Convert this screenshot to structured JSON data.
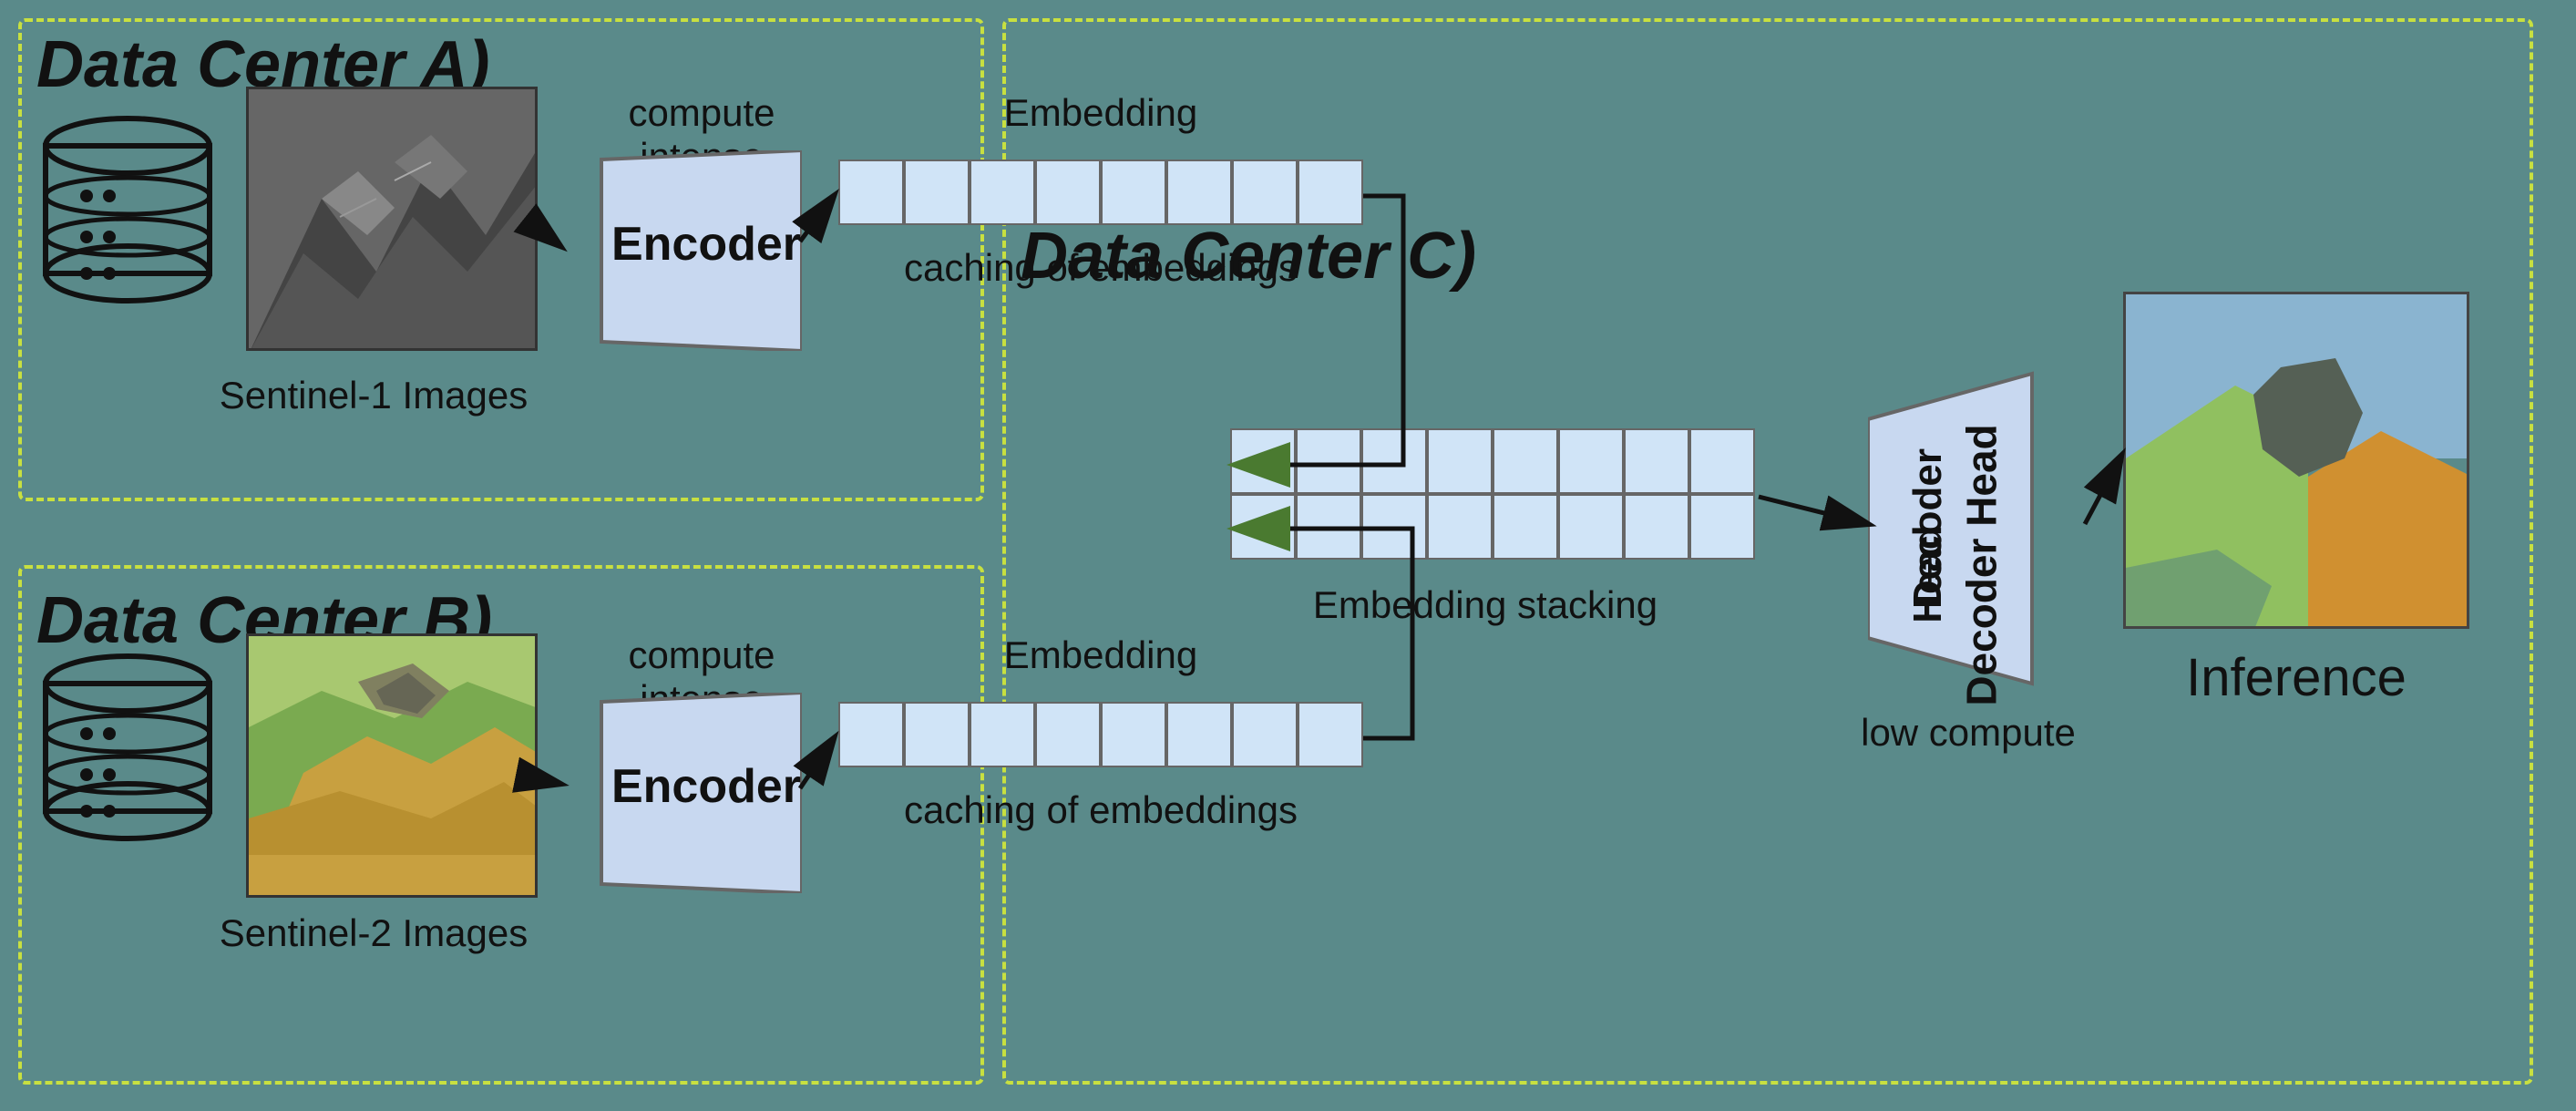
{
  "diagram": {
    "background_color": "#5a8a8a",
    "dashed_border_color": "#c8e040",
    "sections": {
      "a": {
        "title": "Data Center A)",
        "subtitle_image": "Sentinel-1 Images",
        "compute_label": "compute intense",
        "encoder_label": "Encoder",
        "embedding_label": "Embedding",
        "caching_label": "caching of embeddings"
      },
      "b": {
        "title": "Data Center B)",
        "subtitle_image": "Sentinel-2 Images",
        "compute_label": "compute intense",
        "encoder_label": "Encoder",
        "embedding_label": "Embedding",
        "caching_label": "caching of embeddings"
      },
      "c": {
        "title": "Data Center C)",
        "embedding_stacking_label": "Embedding stacking",
        "decoder_label": "Decoder Head",
        "low_compute_label": "low compute",
        "inference_label": "Inference"
      }
    }
  }
}
